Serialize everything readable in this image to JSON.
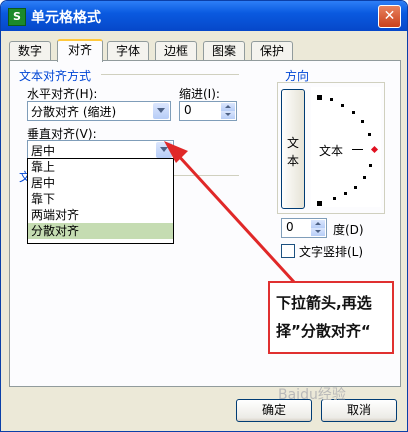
{
  "window": {
    "title": "单元格格式",
    "app_icon_glyph": "S"
  },
  "tabs": [
    {
      "label": "数字"
    },
    {
      "label": "对齐"
    },
    {
      "label": "字体"
    },
    {
      "label": "边框"
    },
    {
      "label": "图案"
    },
    {
      "label": "保护"
    }
  ],
  "alignment": {
    "group_title": "文本对齐方式",
    "horizontal_label": "水平对齐(H):",
    "horizontal_value": "分散对齐 (缩进)",
    "indent_label": "缩进(I):",
    "indent_value": "0",
    "vertical_label": "垂直对齐(V):",
    "vertical_value": "居中",
    "vertical_options": [
      "靠上",
      "居中",
      "靠下",
      "两端对齐",
      "分散对齐"
    ],
    "hidden_group_fragment": "文"
  },
  "orientation": {
    "group_title": "方向",
    "vertical_text": "文本",
    "dial_text": "文本",
    "degree_value": "0",
    "degree_label": "度(D)",
    "vertical_checkbox_label": "文字竖排(L)"
  },
  "buttons": {
    "ok": "确定",
    "cancel": "取消"
  },
  "annotation": {
    "callout_text": "下拉箭头,再选择”分散对齐“"
  },
  "watermark": "Baidu经验",
  "colors": {
    "title_bar": "#0a5ae0",
    "group_title": "#0046d5",
    "annotation": "#e03030",
    "selected_option": "#c5dcb2"
  }
}
